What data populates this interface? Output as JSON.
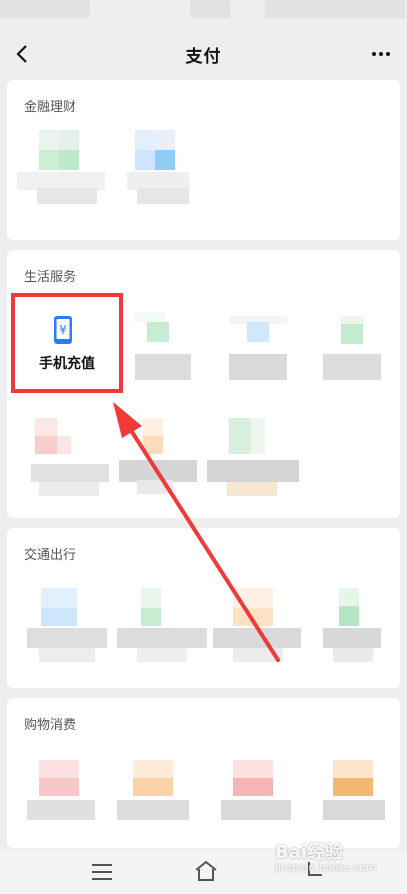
{
  "header": {
    "title": "支付"
  },
  "sections": {
    "finance": {
      "title": "金融理财"
    },
    "life": {
      "title": "生活服务"
    },
    "transport": {
      "title": "交通出行"
    },
    "shopping": {
      "title": "购物消费"
    }
  },
  "highlighted_item": {
    "label": "手机充值",
    "icon": "phone-yen-icon"
  },
  "watermark": {
    "text": "Bai经验",
    "subtext": "jingyan.baidu.com"
  },
  "colors": {
    "highlight": "#f03a3a",
    "arrow": "#f03a3a",
    "icon_blue": "#2b7cff"
  }
}
